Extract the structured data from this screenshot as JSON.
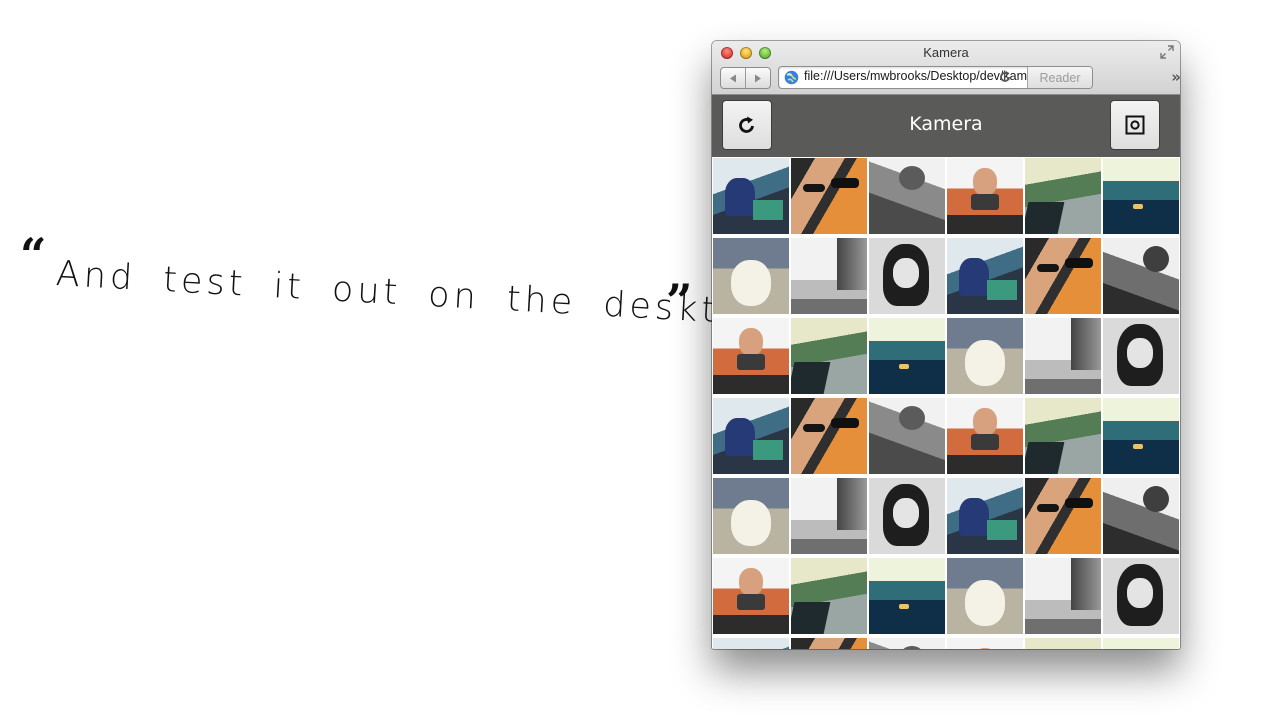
{
  "quote": {
    "open": "“",
    "text": "And test it out on the desktop.",
    "close": "”"
  },
  "browser": {
    "window_title": "Kamera",
    "back_icon": "back-triangle-icon",
    "forward_icon": "forward-triangle-icon",
    "url": "file:///Users/mwbrooks/Desktop/dev/kamera/www/index.html",
    "reader_label": "Reader",
    "overflow_label": "»"
  },
  "app": {
    "title": "Kamera",
    "left_button_icon": "reload-circular-arrow-icon",
    "right_button_icon": "camera-shutter-icon"
  },
  "grid": {
    "columns": 6,
    "photos": [
      "bridge",
      "couple",
      "bwman",
      "camera",
      "road",
      "lake",
      "dog",
      "bwpier",
      "bwwoman",
      "bridge",
      "couple",
      "bwfence",
      "camera",
      "road",
      "lake",
      "dog",
      "bwpier",
      "bwwoman",
      "bridge",
      "couple",
      "bwman",
      "camera",
      "road",
      "lake",
      "dog",
      "bwpier",
      "bwwoman",
      "bridge",
      "couple",
      "bwfence",
      "camera",
      "road",
      "lake",
      "dog",
      "bwpier",
      "bwwoman",
      "bridge",
      "couple",
      "bwman",
      "camera",
      "road",
      "lake"
    ]
  },
  "colors": {
    "app_header": "#5a5b58",
    "page_background": "#ffffff"
  }
}
